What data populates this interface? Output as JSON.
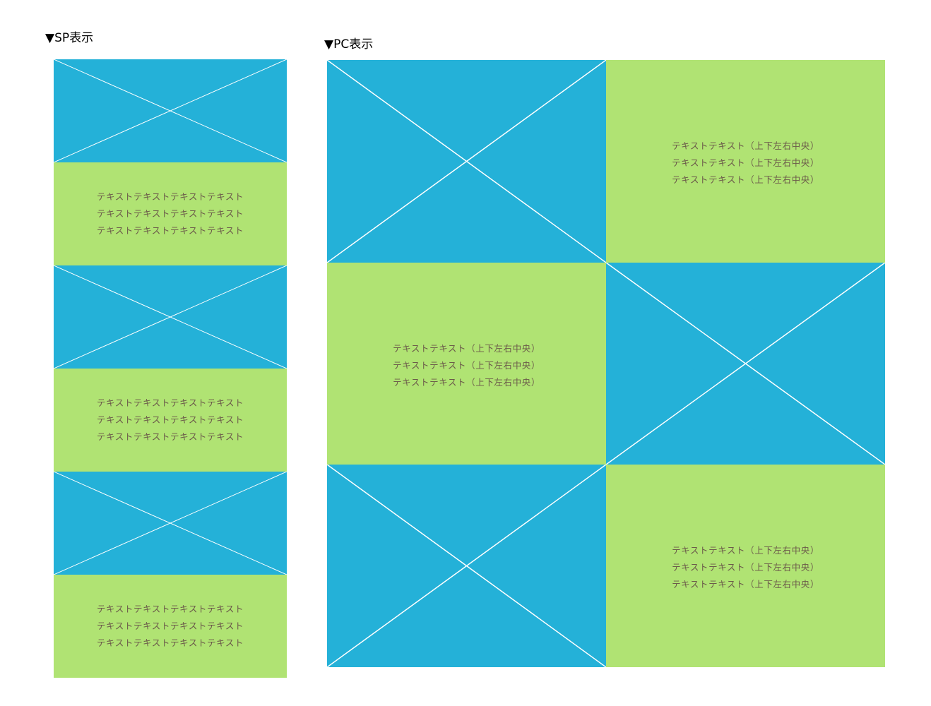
{
  "colors": {
    "image": "#24b1d8",
    "text_block": "#b0e373",
    "text": "#6b5a4a",
    "cross_lines": "#ffffff"
  },
  "sp": {
    "title": "▼SP表示",
    "blocks": [
      {
        "type": "image"
      },
      {
        "type": "text",
        "lines": [
          "テキストテキストテキストテキスト",
          "テキストテキストテキストテキスト",
          "テキストテキストテキストテキスト"
        ]
      },
      {
        "type": "image"
      },
      {
        "type": "text",
        "lines": [
          "テキストテキストテキストテキスト",
          "テキストテキストテキストテキスト",
          "テキストテキストテキストテキスト"
        ]
      },
      {
        "type": "image"
      },
      {
        "type": "text",
        "lines": [
          "テキストテキストテキストテキスト",
          "テキストテキストテキストテキスト",
          "テキストテキストテキストテキスト"
        ]
      }
    ]
  },
  "pc": {
    "title": "▼PC表示",
    "rows": [
      {
        "left": {
          "type": "image"
        },
        "right": {
          "type": "text",
          "lines": [
            "テキストテキスト（上下左右中央）",
            "テキストテキスト（上下左右中央）",
            "テキストテキスト（上下左右中央）"
          ]
        }
      },
      {
        "left": {
          "type": "text",
          "lines": [
            "テキストテキスト（上下左右中央）",
            "テキストテキスト（上下左右中央）",
            "テキストテキスト（上下左右中央）"
          ]
        },
        "right": {
          "type": "image"
        }
      },
      {
        "left": {
          "type": "image"
        },
        "right": {
          "type": "text",
          "lines": [
            "テキストテキスト（上下左右中央）",
            "テキストテキスト（上下左右中央）",
            "テキストテキスト（上下左右中央）"
          ]
        }
      }
    ]
  }
}
